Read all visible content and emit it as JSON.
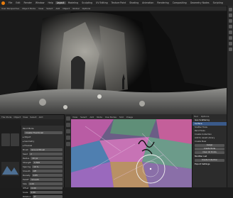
{
  "topbar": {
    "tabs": [
      "File",
      "Edit",
      "Render",
      "Window",
      "Help",
      "Layout",
      "Modeling",
      "Sculpting",
      "UV Editing",
      "Texture Paint",
      "Shading",
      "Animation",
      "Rendering",
      "Compositing",
      "Geometry Nodes",
      "Scripting"
    ],
    "active_tab_index": 5
  },
  "viewport": {
    "header": [
      "User Perspective",
      "Object Mode",
      "View",
      "Select",
      "Add",
      "Object",
      "Global",
      "Options"
    ]
  },
  "bottom_left": {
    "header": [
      "Tile Mode",
      "Object",
      "View",
      "Select",
      "Add"
    ],
    "properties": {
      "panel_label": "Paint Mode",
      "mode_value": "Create Thumbnail",
      "sections": [
        "Object",
        "Geometry",
        "Preview"
      ],
      "rows": [
        [
          "Brush",
          "Ground Brush"
        ],
        [
          "Seed",
          "2"
        ],
        [
          "Radius",
          "20 px"
        ],
        [
          "Strength",
          "0.500"
        ],
        [
          "Spacing",
          "10 %"
        ],
        [
          "Smooth",
          "Off"
        ],
        [
          "Density",
          "0.85"
        ],
        [
          "Falloff",
          "Smooth"
        ],
        [
          "Size",
          "1.00"
        ],
        [
          "Offset",
          "0.00"
        ],
        [
          "Scale",
          "1.00"
        ],
        [
          "Rotation",
          "0°"
        ]
      ]
    }
  },
  "node_editor": {
    "header": [
      "View",
      "Select",
      "Add",
      "Node",
      "Use Nodes",
      "Slot",
      "Image"
    ]
  },
  "sidebar_panel": {
    "tabs": [
      "Tool",
      "Options"
    ],
    "title": "Geo Scattering",
    "rows": [
      "Surface",
      "Scatter Tools",
      "Paint Tools",
      "Create Collection",
      "Add to Asset Library",
      "Create New"
    ],
    "buttons": [
      "Assign",
      "Create Node",
      "Clear All Points"
    ],
    "section2": "Modifier List",
    "button2": "Create Collection",
    "section3": "Export Settings"
  },
  "colors": {
    "accent": "#e87d0d",
    "panel_bg": "#2b2b2b",
    "selection": "#3a5a8a"
  }
}
